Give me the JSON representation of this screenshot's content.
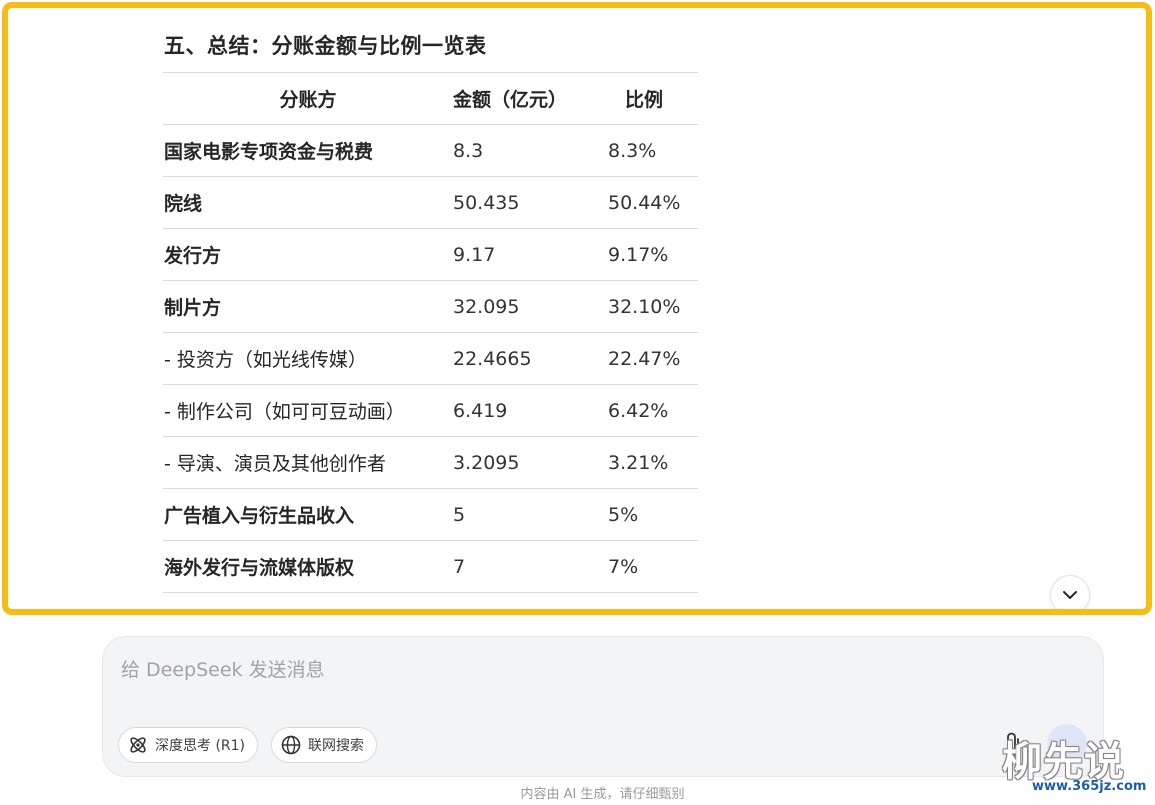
{
  "section": {
    "title": "五、总结：分账金额与比例一览表"
  },
  "table": {
    "headers": {
      "party": "分账方",
      "amount": "金额（亿元）",
      "ratio": "比例"
    },
    "rows": [
      {
        "party": "国家电影专项资金与税费",
        "amount": "8.3",
        "ratio": "8.3%",
        "bold": true
      },
      {
        "party": "院线",
        "amount": "50.435",
        "ratio": "50.44%",
        "bold": true
      },
      {
        "party": "发行方",
        "amount": "9.17",
        "ratio": "9.17%",
        "bold": true
      },
      {
        "party": "制片方",
        "amount": "32.095",
        "ratio": "32.10%",
        "bold": true
      },
      {
        "party": "- 投资方（如光线传媒）",
        "amount": "22.4665",
        "ratio": "22.47%",
        "bold": false
      },
      {
        "party": "- 制作公司（如可可豆动画）",
        "amount": "6.419",
        "ratio": "6.42%",
        "bold": false
      },
      {
        "party": "- 导演、演员及其他创作者",
        "amount": "3.2095",
        "ratio": "3.21%",
        "bold": false
      },
      {
        "party": "广告植入与衍生品收入",
        "amount": "5",
        "ratio": "5%",
        "bold": true
      },
      {
        "party": "海外发行与流媒体版权",
        "amount": "7",
        "ratio": "7%",
        "bold": true
      }
    ]
  },
  "composer": {
    "placeholder": "给 DeepSeek 发送消息",
    "deep_think_label": "深度思考 (R1)",
    "web_search_label": "联网搜索",
    "deep_think_icon": "atom-icon",
    "web_search_icon": "globe-icon",
    "attach_icon": "paperclip-icon"
  },
  "footer": {
    "note": "内容由 AI 生成，请仔细甄别"
  },
  "watermark": {
    "text": "柳先说",
    "url": "www.365jz.com"
  },
  "colors": {
    "highlight_border": "#f6bd16",
    "composer_bg": "#f3f4f6",
    "watermark_url": "#1d5fa8"
  }
}
